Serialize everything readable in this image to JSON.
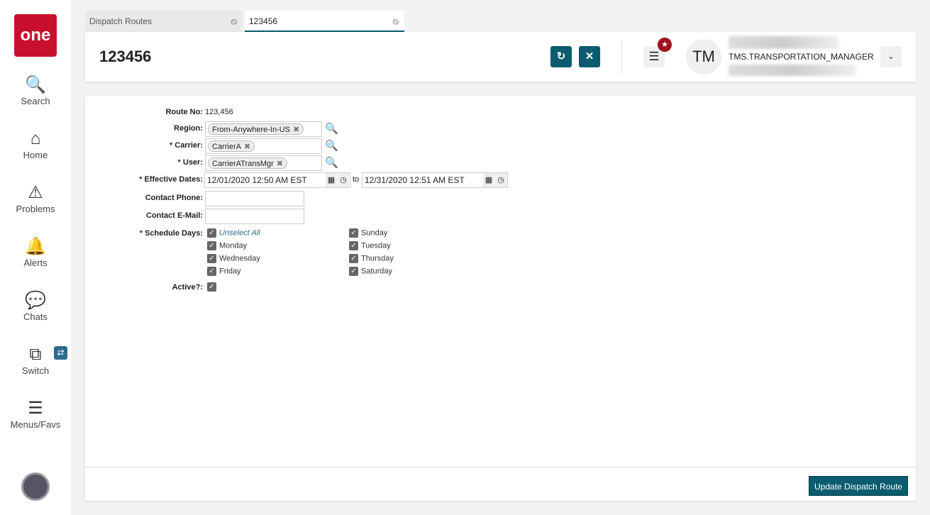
{
  "sidebar": {
    "logo": "one",
    "items": [
      {
        "label": "Search"
      },
      {
        "label": "Home"
      },
      {
        "label": "Problems"
      },
      {
        "label": "Alerts"
      },
      {
        "label": "Chats"
      },
      {
        "label": "Switch"
      },
      {
        "label": "Menus/Favs"
      }
    ]
  },
  "tabs": [
    {
      "label": "Dispatch Routes"
    },
    {
      "label": "123456"
    }
  ],
  "header": {
    "title": "123456",
    "avatar_initials": "TM",
    "username": "TMS.TRANSPORTATION_MANAGER"
  },
  "form": {
    "route_no_label": "Route No:",
    "route_no": "123,456",
    "region_label": "Region:",
    "region": "From-Anywhere-In-US",
    "carrier_label": "Carrier:",
    "carrier": "CarrierA",
    "user_label": "User:",
    "user": "CarrierATransMgr",
    "dates_label": "Effective Dates:",
    "start_date": "12/01/2020 12:50 AM EST",
    "to": "to",
    "end_date": "12/31/2020 12:51 AM EST",
    "phone_label": "Contact Phone:",
    "phone": "",
    "email_label": "Contact E-Mail:",
    "email": "",
    "days_label": "Schedule Days:",
    "unselect_all": "Unselect All",
    "days": [
      "Sunday",
      "Monday",
      "Tuesday",
      "Wednesday",
      "Thursday",
      "Friday",
      "Saturday"
    ],
    "active_label": "Active?:"
  },
  "footer": {
    "update_label": "Update Dispatch Route"
  }
}
